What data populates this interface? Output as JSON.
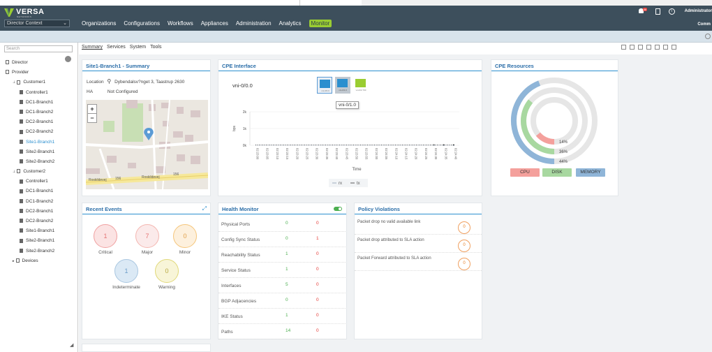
{
  "header": {
    "brand": "VERSA",
    "brand_sub": "NETWORKS",
    "context": "Director Context",
    "nav": [
      "Organizations",
      "Configurations",
      "Workflows",
      "Appliances",
      "Administration",
      "Analytics",
      "Monitor"
    ],
    "active_nav": "Monitor",
    "alert_badge": "88",
    "user": "Administrator",
    "org": "Comm"
  },
  "sidebar": {
    "search_placeholder": "Search",
    "tree": [
      {
        "label": "Director",
        "level": 0
      },
      {
        "label": "Provider",
        "level": 0
      },
      {
        "label": "Customer1",
        "level": 1
      },
      {
        "label": "Controller1",
        "level": 2
      },
      {
        "label": "DC1-Branch1",
        "level": 2
      },
      {
        "label": "DC1-Branch2",
        "level": 2
      },
      {
        "label": "DC2-Branch1",
        "level": 2
      },
      {
        "label": "DC2-Branch2",
        "level": 2
      },
      {
        "label": "Site1-Branch1",
        "level": 2,
        "selected": true
      },
      {
        "label": "Site2-Branch1",
        "level": 2
      },
      {
        "label": "Site2-Branch2",
        "level": 2
      },
      {
        "label": "Customer2",
        "level": 1
      },
      {
        "label": "Controller1",
        "level": 2
      },
      {
        "label": "DC1-Branch1",
        "level": 2
      },
      {
        "label": "DC1-Branch2",
        "level": 2
      },
      {
        "label": "DC2-Branch1",
        "level": 2
      },
      {
        "label": "DC2-Branch2",
        "level": 2
      },
      {
        "label": "Site1-Branch1",
        "level": 2
      },
      {
        "label": "Site2-Branch1",
        "level": 2
      },
      {
        "label": "Site2-Branch2",
        "level": 2
      },
      {
        "label": "Devices",
        "level": 1
      }
    ]
  },
  "tabs": [
    "Summary",
    "Services",
    "System",
    "Tools"
  ],
  "summary": {
    "title": "Site1-Branch1 - Summary",
    "location_label": "Location",
    "location_value": "Dybendalsv?nget 3, Taastrup 2630",
    "ha_label": "HA",
    "ha_value": "Not Configured",
    "map_labels": [
      "Roskildevej",
      "156",
      "Roskildevej",
      "156"
    ]
  },
  "cpe_interface": {
    "title": "CPE Interface",
    "interface": "vni-0/0.0",
    "tooltip": "vni-0/1.0",
    "icon_labels": [
      "vni-0/0.0",
      "vni-0/1.0",
      "vni-0/2.700"
    ],
    "y_label": "bps",
    "y_ticks": [
      "2k",
      "1k",
      "0k"
    ],
    "x_label": "Time",
    "x_ticks": [
      "02:23:00",
      "02:23:05",
      "02:23:10",
      "02:23:15",
      "02:23:20",
      "02:23:25",
      "02:23:30",
      "02:23:35",
      "02:23:40",
      "02:23:45",
      "02:23:50",
      "02:23:55",
      "02:24:00",
      "02:24:05",
      "02:24:10",
      "02:24:15",
      "02:24:20",
      "02:24:25",
      "02:24:30",
      "02:24:35",
      "02:24:40"
    ],
    "legend": [
      "rx",
      "tx"
    ]
  },
  "chart_data": {
    "type": "line",
    "title": "",
    "xlabel": "Time",
    "ylabel": "bps",
    "ylim": [
      0,
      2000
    ],
    "x": [
      "02:23:00",
      "02:23:05",
      "02:23:10",
      "02:23:15",
      "02:23:20",
      "02:23:25",
      "02:23:30",
      "02:23:35",
      "02:23:40",
      "02:23:45",
      "02:23:50",
      "02:23:55",
      "02:24:00",
      "02:24:05",
      "02:24:10",
      "02:24:15",
      "02:24:20",
      "02:24:25",
      "02:24:30",
      "02:24:35",
      "02:24:40"
    ],
    "series": [
      {
        "name": "rx",
        "values": [
          0,
          0,
          0,
          0,
          0,
          0,
          0,
          0,
          0,
          0,
          0,
          0,
          0,
          0,
          0,
          0,
          0,
          0,
          0,
          0,
          0
        ]
      },
      {
        "name": "tx",
        "values": [
          0,
          0,
          0,
          0,
          0,
          0,
          0,
          0,
          0,
          0,
          0,
          0,
          0,
          0,
          0,
          0,
          0,
          0,
          0,
          0,
          0
        ]
      }
    ]
  },
  "cpe_resources": {
    "title": "CPE Resources",
    "cpu": {
      "label": "CPU",
      "percent": 14,
      "text": "14%",
      "color": "#f4a09c"
    },
    "disk": {
      "label": "DISK",
      "percent": 36,
      "text": "36%",
      "color": "#a8d8a0"
    },
    "memory": {
      "label": "MEMORY",
      "percent": 44,
      "text": "44%",
      "color": "#8fb5d8"
    }
  },
  "recent_events": {
    "title": "Recent Events",
    "items": [
      {
        "label": "Critical",
        "count": "1",
        "bg": "#fbe3e3",
        "border": "#f0a0a0",
        "color": "#e57373"
      },
      {
        "label": "Major",
        "count": "7",
        "bg": "#fbeaea",
        "border": "#f4b6b0",
        "color": "#e57373"
      },
      {
        "label": "Minor",
        "count": "0",
        "bg": "#fdf0dd",
        "border": "#f5c57a",
        "color": "#e0a04a"
      },
      {
        "label": "Indeterminate",
        "count": "1",
        "bg": "#dbe9f5",
        "border": "#a8c6e0",
        "color": "#6b9cc8"
      },
      {
        "label": "Warning",
        "count": "0",
        "bg": "#f8f5d8",
        "border": "#e0d878",
        "color": "#b8a840"
      }
    ]
  },
  "health_monitor": {
    "title": "Health Monitor",
    "rows": [
      {
        "name": "Physical Ports",
        "up": "0",
        "down": "0"
      },
      {
        "name": "Config Sync Status",
        "up": "0",
        "down": "1"
      },
      {
        "name": "Reachability Status",
        "up": "1",
        "down": "0"
      },
      {
        "name": "Service Status",
        "up": "1",
        "down": "0"
      },
      {
        "name": "Interfaces",
        "up": "5",
        "down": "0"
      },
      {
        "name": "BGP Adjacencies",
        "up": "0",
        "down": "0"
      },
      {
        "name": "IKE Status",
        "up": "1",
        "down": "0"
      },
      {
        "name": "Paths",
        "up": "14",
        "down": "0"
      }
    ]
  },
  "policy_violations": {
    "title": "Policy Violations",
    "rows": [
      {
        "name": "Packet drop no valid available link",
        "count": "0"
      },
      {
        "name": "Packet drop attributed to SLA action",
        "count": "0"
      },
      {
        "name": "Packet Forward attributed to SLA action",
        "count": "0"
      }
    ]
  }
}
